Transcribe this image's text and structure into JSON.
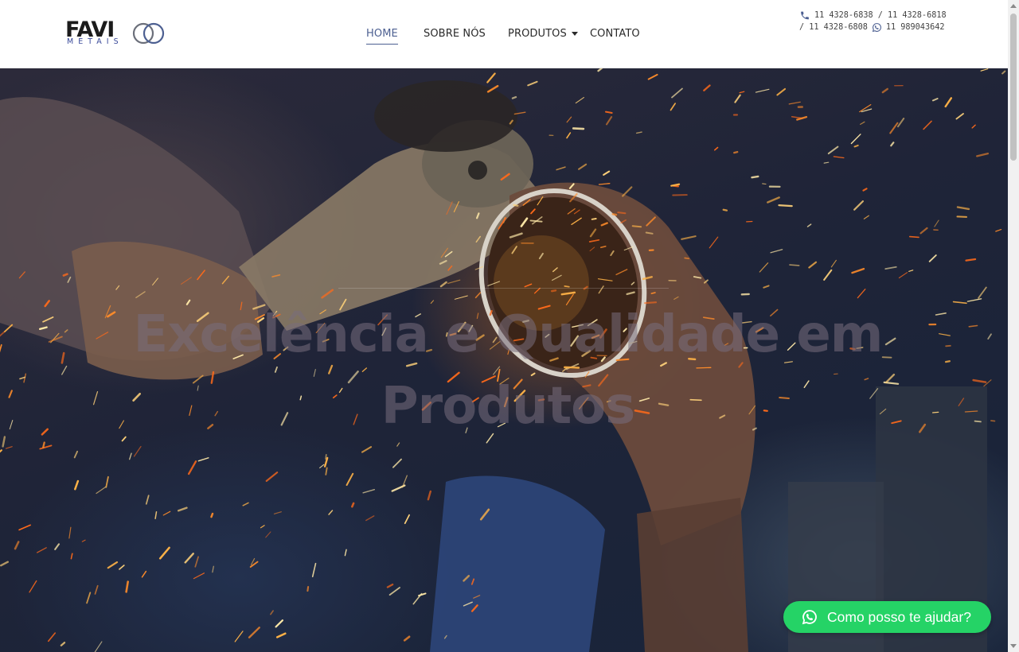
{
  "brand": {
    "name": "FAVI",
    "sub": "METAIS",
    "ring_color": "#4c5f91"
  },
  "nav": {
    "items": [
      {
        "label": "HOME",
        "active": true
      },
      {
        "label": "SOBRE NÓS",
        "active": false
      },
      {
        "label": "PRODUTOS",
        "active": false,
        "has_dropdown": true
      },
      {
        "label": "CONTATO",
        "active": false
      }
    ],
    "active_color": "#4c5f91"
  },
  "contacts": {
    "line1": "11 4328-6838 / 11 4328-6818",
    "line2_phone": "/ 11 4328-6808",
    "line2_whatsapp": "11 989043642",
    "icons": [
      "phone-icon",
      "whatsapp-icon"
    ]
  },
  "hero": {
    "title": "Excelência e Qualidade em Produtos"
  },
  "whatsapp_button": {
    "label": "Como posso te ajudar?",
    "color": "#25d366",
    "icon": "whatsapp-icon"
  }
}
